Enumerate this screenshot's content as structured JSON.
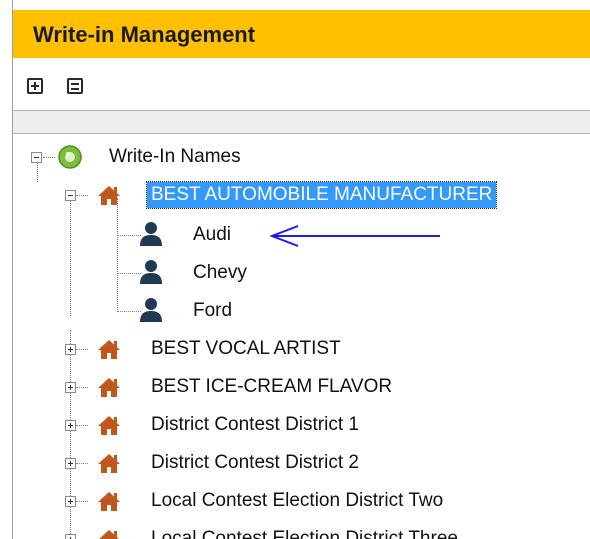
{
  "panel": {
    "title": "Write-in Management"
  },
  "toolbar": {
    "expand_all_icon": "expand-all-icon",
    "collapse_all_icon": "collapse-all-icon"
  },
  "tree": {
    "root": {
      "label": "Write-In Names",
      "icon": "green-circle-icon",
      "expanded": true
    },
    "contests": [
      {
        "label": "BEST AUTOMOBILE MANUFACTURER",
        "expanded": true,
        "selected": true,
        "children": [
          {
            "label": "Audi"
          },
          {
            "label": "Chevy"
          },
          {
            "label": "Ford"
          }
        ]
      },
      {
        "label": "BEST VOCAL ARTIST",
        "expanded": false
      },
      {
        "label": "BEST ICE-CREAM FLAVOR",
        "expanded": false
      },
      {
        "label": "District Contest District 1",
        "expanded": false
      },
      {
        "label": "District Contest District 2",
        "expanded": false
      },
      {
        "label": "Local Contest Election District Two",
        "expanded": false
      },
      {
        "label": "Local Contest Election District Three",
        "expanded": false
      }
    ]
  },
  "annotation": {
    "arrow_color": "#1a1aff"
  },
  "colors": {
    "title_bar": "#ffc000",
    "selection": "#3399ff",
    "house_icon": "#c0581c",
    "person_icon": "#1f3a52"
  }
}
